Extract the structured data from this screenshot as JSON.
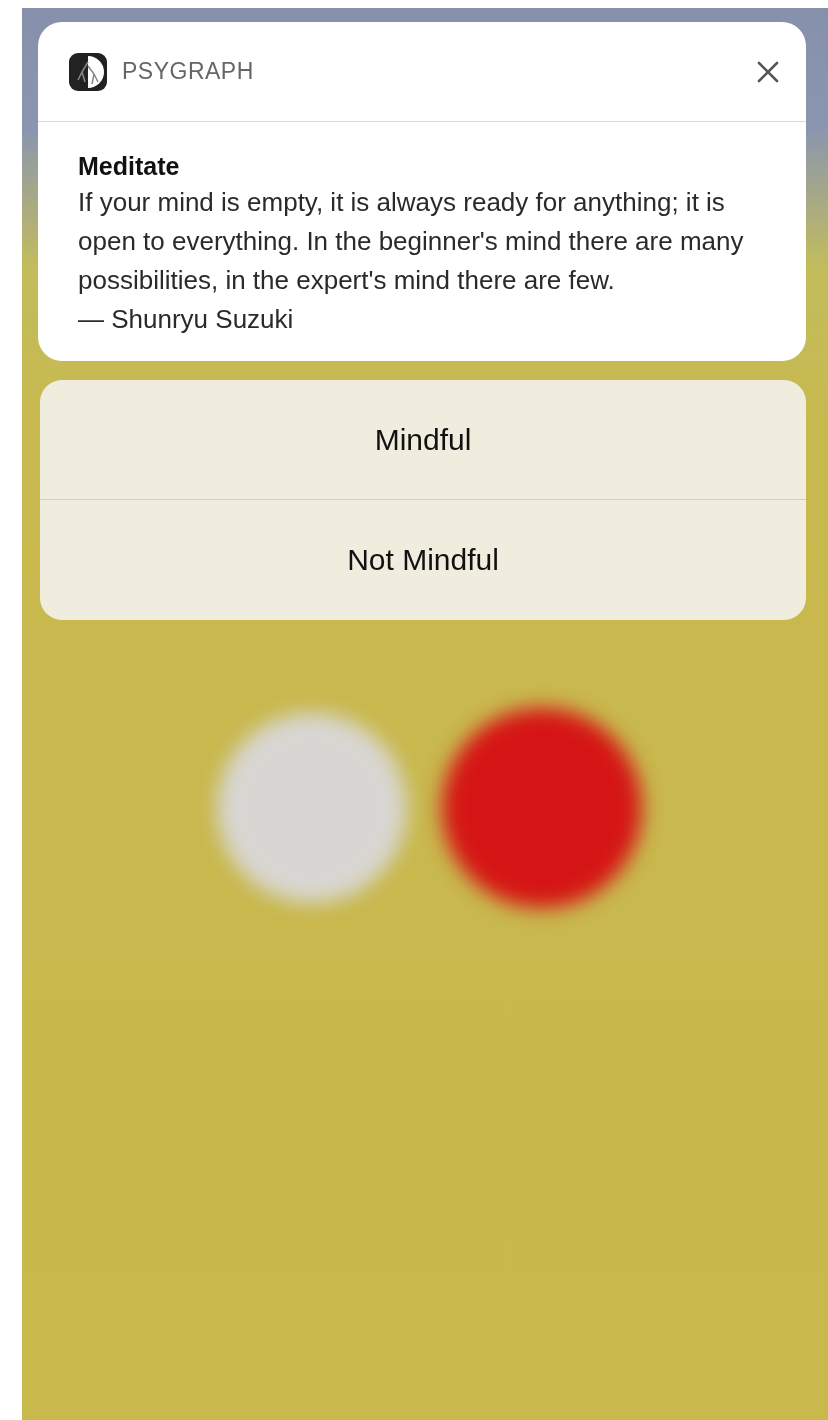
{
  "notification": {
    "app_name": "PSYGRAPH",
    "title": "Meditate",
    "body": "If your mind is empty, it is always ready for anything; it is open to everything. In the beginner's mind there are many possibilities, in the expert's mind there are few.",
    "attribution": "— Shunryu Suzuki"
  },
  "actions": [
    {
      "label": "Mindful"
    },
    {
      "label": "Not Mindful"
    }
  ]
}
